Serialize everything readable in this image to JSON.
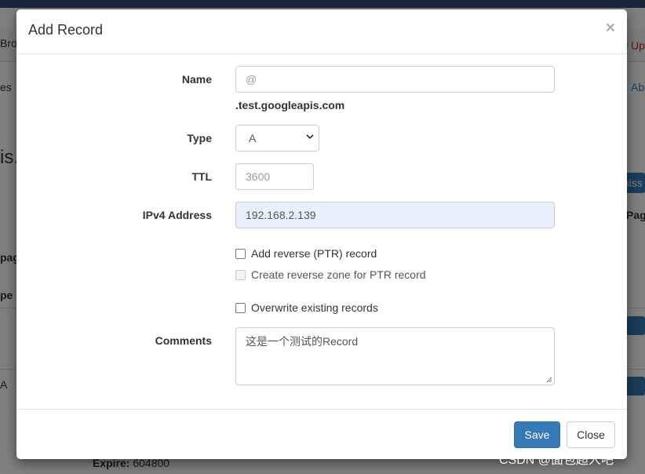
{
  "background": {
    "nav_left": "Bro",
    "nav_right": "w Up",
    "left_fragments": [
      "es",
      "is.",
      "pag",
      "pe",
      "A"
    ],
    "right_fragments": [
      "Abo",
      "miss",
      "Pag"
    ],
    "footer_label": "Expire:",
    "footer_value": "604800"
  },
  "modal": {
    "title": "Add Record",
    "close_symbol": "×",
    "fields": {
      "name": {
        "label": "Name",
        "placeholder": "@",
        "suffix": ".test.googleapis.com"
      },
      "type": {
        "label": "Type",
        "value": "A"
      },
      "ttl": {
        "label": "TTL",
        "placeholder": "3600"
      },
      "ipv4": {
        "label": "IPv4 Address",
        "value": "192.168.2.139"
      },
      "comments": {
        "label": "Comments",
        "value": "这是一个测试的Record"
      }
    },
    "checkboxes": {
      "add_ptr": "Add reverse (PTR) record",
      "create_zone": "Create reverse zone for PTR record",
      "overwrite": "Overwrite existing records"
    },
    "footer": {
      "save_label": "Save",
      "close_label": "Close"
    }
  },
  "watermark": "CSDN @面包超人吧",
  "colors": {
    "primary": "#337ab7",
    "autofill": "#e8f0fe",
    "topbar": "#2f4d7a"
  }
}
